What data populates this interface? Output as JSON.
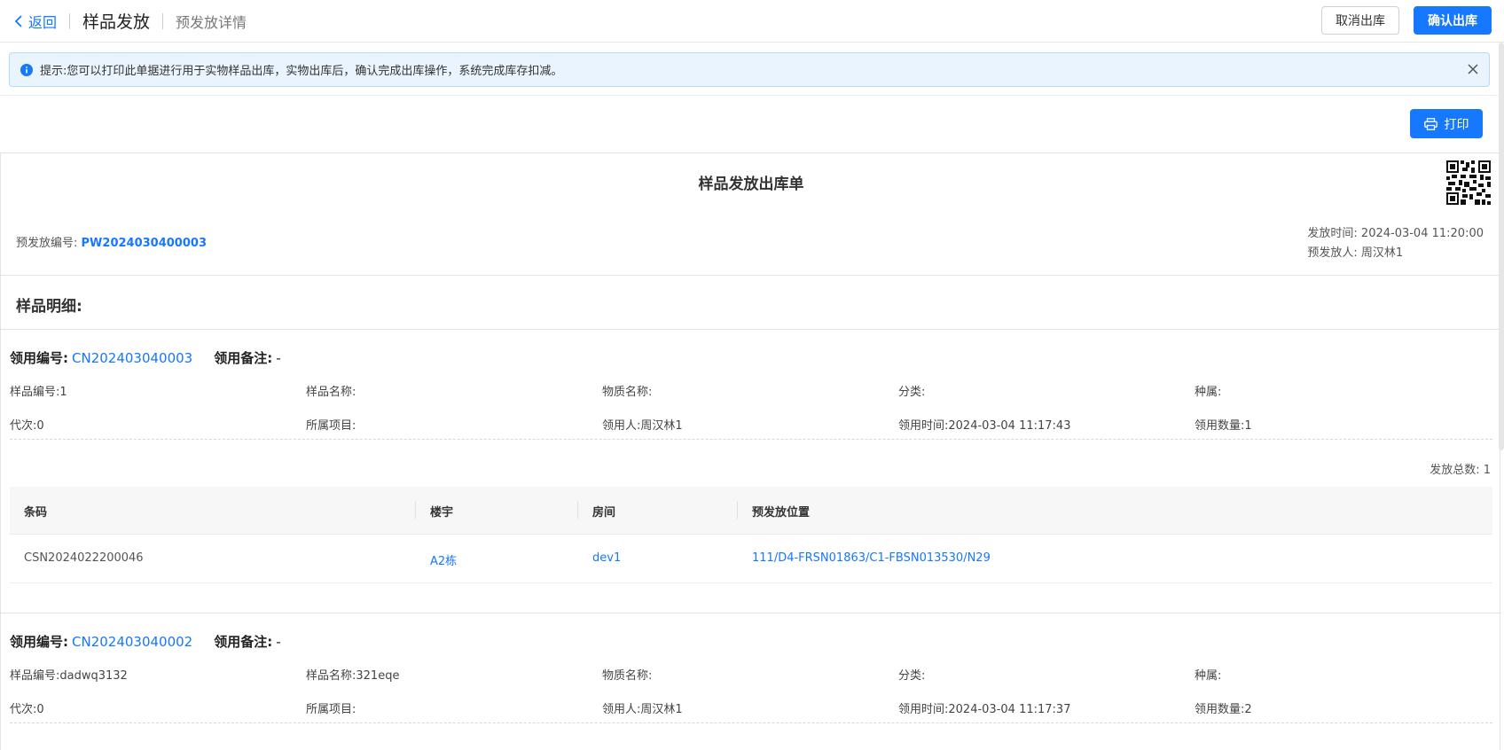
{
  "header": {
    "back_label": "返回",
    "title": "样品发放",
    "subtitle": "预发放详情",
    "cancel_label": "取消出库",
    "confirm_label": "确认出库"
  },
  "alert": {
    "text": "提示:您可以打印此单据进行用于实物样品出库，实物出库后，确认完成出库操作，系统完成库存扣减。"
  },
  "print_label": "打印",
  "doc": {
    "title": "样品发放出库单",
    "pw_label": "预发放编号:",
    "pw_value": "PW2024030400003",
    "issue_time_label": "发放时间:",
    "issue_time": "2024-03-04 11:20:00",
    "issuer_label": "预发放人:",
    "issuer": "周汉林1",
    "section_title": "样品明细:"
  },
  "requests": [
    {
      "code_label": "领用编号:",
      "code": "CN202403040003",
      "note_label": "领用备注:",
      "note": "-",
      "fields_row1": [
        {
          "label": "样品编号:",
          "value": "1"
        },
        {
          "label": "样品名称:",
          "value": ""
        },
        {
          "label": "物质名称:",
          "value": ""
        },
        {
          "label": "分类:",
          "value": ""
        },
        {
          "label": "种属:",
          "value": ""
        }
      ],
      "fields_row2": [
        {
          "label": "代次:",
          "value": "0"
        },
        {
          "label": "所属项目:",
          "value": ""
        },
        {
          "label": "领用人:",
          "value": "周汉林1"
        },
        {
          "label": "领用时间:",
          "value": "2024-03-04 11:17:43"
        },
        {
          "label": "领用数量:",
          "value": "1"
        }
      ],
      "total_text": "发放总数: 1",
      "table": {
        "headers": [
          "条码",
          "楼宇",
          "房间",
          "预发放位置"
        ],
        "rows": [
          [
            "CSN2024022200046",
            "A2栋",
            "dev1",
            "111/D4-FRSN01863/C1-FBSN013530/N29"
          ]
        ]
      }
    },
    {
      "code_label": "领用编号:",
      "code": "CN202403040002",
      "note_label": "领用备注:",
      "note": "-",
      "fields_row1": [
        {
          "label": "样品编号:",
          "value": "dadwq3132"
        },
        {
          "label": "样品名称:",
          "value": "321eqe"
        },
        {
          "label": "物质名称:",
          "value": ""
        },
        {
          "label": "分类:",
          "value": ""
        },
        {
          "label": "种属:",
          "value": ""
        }
      ],
      "fields_row2": [
        {
          "label": "代次:",
          "value": "0"
        },
        {
          "label": "所属项目:",
          "value": ""
        },
        {
          "label": "领用人:",
          "value": "周汉林1"
        },
        {
          "label": "领用时间:",
          "value": "2024-03-04 11:17:37"
        },
        {
          "label": "领用数量:",
          "value": "2"
        }
      ]
    }
  ]
}
